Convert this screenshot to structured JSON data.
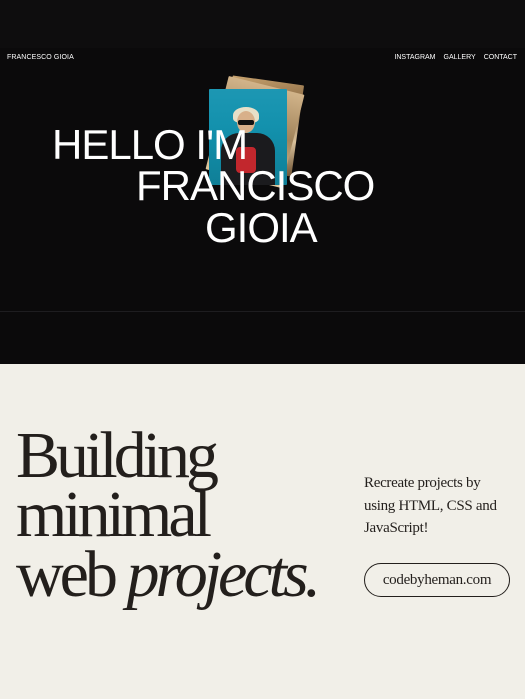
{
  "header": {
    "brand": "FRANCESCO GIOIA",
    "nav": [
      "INSTAGRAM",
      "GALLERY",
      "CONTACT"
    ]
  },
  "hero": {
    "line1": "HELLO I'M",
    "line2": "FRANCISCO",
    "line3": "GIOIA"
  },
  "intro": {
    "heading_line1": "Building",
    "heading_line2": "minimal",
    "heading_word": "web",
    "heading_italic": "projects.",
    "description": "Recreate projects by using HTML, CSS and JavaScript!",
    "cta_label": "codebyheman.com"
  },
  "colors": {
    "dark_bg": "#0b0a0b",
    "light_bg": "#f1efe8",
    "ink": "#231f1c",
    "photo_teal": "#1391ad"
  }
}
